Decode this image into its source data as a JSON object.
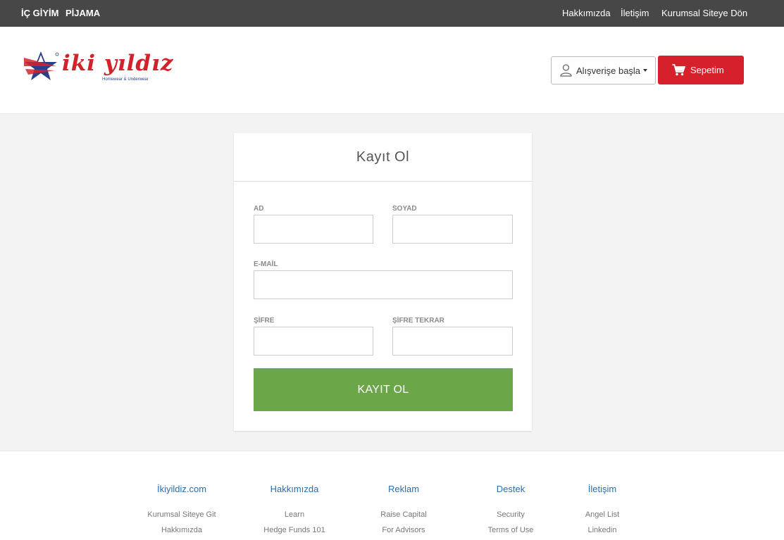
{
  "topbar": {
    "categories": [
      "İÇ GİYİM",
      "PİJAMA"
    ],
    "links": [
      "Hakkımızda",
      "İletişim",
      "Kurumsal Siteye Dön"
    ]
  },
  "brand": {
    "name": "iki yıldız",
    "tagline": "Homewear & Underwear",
    "colors": {
      "red": "#d2232a",
      "blue": "#2b3e8f"
    }
  },
  "header": {
    "account_label": "Alışverişe başla",
    "account_icon": "user-icon",
    "cart_label": "Sepetim",
    "cart_icon": "cart-icon"
  },
  "form": {
    "title": "Kayıt Ol",
    "fields": {
      "first_name": {
        "label": "AD",
        "value": ""
      },
      "last_name": {
        "label": "SOYAD",
        "value": ""
      },
      "email": {
        "label": "E-MAİL",
        "value": ""
      },
      "password": {
        "label": "ŞİFRE",
        "value": ""
      },
      "password_repeat": {
        "label": "ŞİFRE TEKRAR",
        "value": ""
      }
    },
    "submit_label": "KAYIT OL"
  },
  "footer": {
    "columns": [
      {
        "title": "İkiyildiz.com",
        "links": [
          "Kurumsal Siteye Git",
          "Hakkımızda"
        ]
      },
      {
        "title": "Hakkımızda",
        "links": [
          "Learn",
          "Hedge Funds 101"
        ]
      },
      {
        "title": "Reklam",
        "links": [
          "Raise Capital",
          "For Advisors"
        ]
      },
      {
        "title": "Destek",
        "links": [
          "Security",
          "Terms of Use"
        ]
      },
      {
        "title": "İletişim",
        "links": [
          "Angel List",
          "Linkedin"
        ]
      }
    ]
  },
  "colors": {
    "topbar_bg": "#474747",
    "cart_button": "#d6202c",
    "submit_button": "#6ba648",
    "footer_link": "#2a6eab"
  }
}
